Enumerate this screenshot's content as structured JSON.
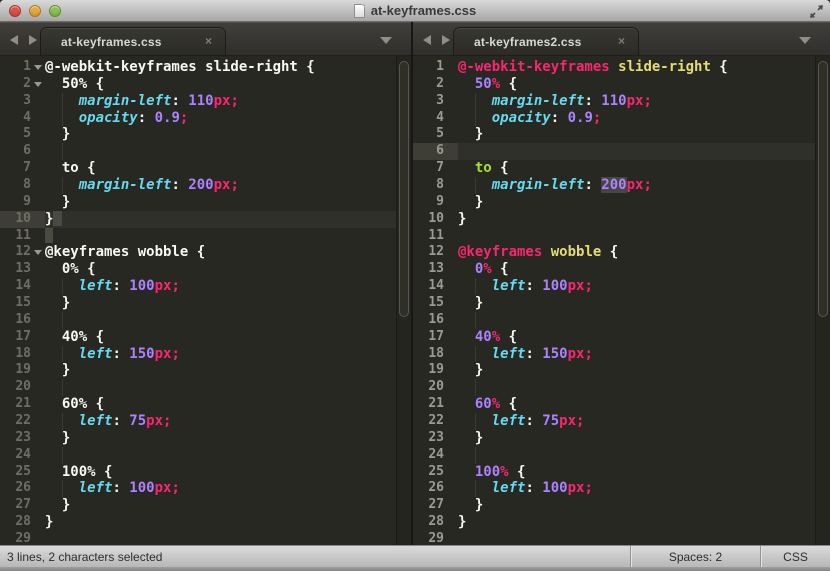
{
  "window": {
    "title": "at-keyframes.css"
  },
  "icons": {
    "tab_close": "×",
    "tab_overflow": "dropdown-triangle",
    "nav_back": "left-triangle",
    "nav_forward": "right-triangle",
    "fullscreen": "diagonal-expand-arrows",
    "traffic": [
      "close",
      "minimize",
      "zoom"
    ]
  },
  "colors": {
    "editor_bg": "#272822",
    "fg": "#f8f8f2",
    "property": "#66d9ef",
    "number": "#ae81ff",
    "unit": "#f92672",
    "at_keyword": "#f92672",
    "name": "#e6db74",
    "keyword": "#a6e22e",
    "selection": "#4b4a40"
  },
  "status_bar": {
    "left": "3 lines, 2 characters selected",
    "spaces": "Spaces: 2",
    "syntax": "CSS"
  },
  "panes": [
    {
      "tab": {
        "label": "at-keyframes.css"
      },
      "lines": [
        {
          "n": 1,
          "f": 1,
          "t": [
            [
              "w",
              "@-webkit-keyframes slide-right {"
            ]
          ]
        },
        {
          "n": 2,
          "f": 1,
          "t": [
            [
              "w",
              "  50% {"
            ]
          ]
        },
        {
          "n": 3,
          "g": [
            2
          ],
          "t": [
            [
              "w",
              "    "
            ],
            [
              "p",
              "margin-left"
            ],
            [
              "w",
              ": "
            ],
            [
              "n",
              "110"
            ],
            [
              "u",
              "px;"
            ]
          ]
        },
        {
          "n": 4,
          "g": [
            2
          ],
          "t": [
            [
              "w",
              "    "
            ],
            [
              "p",
              "opacity"
            ],
            [
              "w",
              ": "
            ],
            [
              "n",
              "0.9"
            ],
            [
              "u",
              ";"
            ]
          ]
        },
        {
          "n": 5,
          "t": [
            [
              "w",
              "  }"
            ]
          ]
        },
        {
          "n": 6,
          "g": [
            2
          ],
          "t": []
        },
        {
          "n": 7,
          "t": [
            [
              "w",
              "  to {"
            ]
          ]
        },
        {
          "n": 8,
          "g": [
            2
          ],
          "t": [
            [
              "w",
              "    "
            ],
            [
              "p",
              "margin-left"
            ],
            [
              "w",
              ": "
            ],
            [
              "n",
              "200"
            ],
            [
              "u",
              "px;"
            ]
          ]
        },
        {
          "n": 9,
          "t": [
            [
              "w",
              "  }"
            ]
          ]
        },
        {
          "n": 10,
          "a": 1,
          "t": [
            [
              "w",
              "}"
            ],
            [
              "s",
              " "
            ]
          ]
        },
        {
          "n": 11,
          "t": [
            [
              "s",
              " "
            ]
          ]
        },
        {
          "n": 12,
          "f": 1,
          "t": [
            [
              "w",
              "@keyframes wobble {"
            ]
          ]
        },
        {
          "n": 13,
          "t": [
            [
              "w",
              "  0% {"
            ]
          ]
        },
        {
          "n": 14,
          "g": [
            2
          ],
          "t": [
            [
              "w",
              "    "
            ],
            [
              "p",
              "left"
            ],
            [
              "w",
              ": "
            ],
            [
              "n",
              "100"
            ],
            [
              "u",
              "px;"
            ]
          ]
        },
        {
          "n": 15,
          "t": [
            [
              "w",
              "  }"
            ]
          ]
        },
        {
          "n": 16,
          "g": [
            2
          ],
          "t": []
        },
        {
          "n": 17,
          "t": [
            [
              "w",
              "  40% {"
            ]
          ]
        },
        {
          "n": 18,
          "g": [
            2
          ],
          "t": [
            [
              "w",
              "    "
            ],
            [
              "p",
              "left"
            ],
            [
              "w",
              ": "
            ],
            [
              "n",
              "150"
            ],
            [
              "u",
              "px;"
            ]
          ]
        },
        {
          "n": 19,
          "t": [
            [
              "w",
              "  }"
            ]
          ]
        },
        {
          "n": 20,
          "g": [
            2
          ],
          "t": []
        },
        {
          "n": 21,
          "t": [
            [
              "w",
              "  60% {"
            ]
          ]
        },
        {
          "n": 22,
          "g": [
            2
          ],
          "t": [
            [
              "w",
              "    "
            ],
            [
              "p",
              "left"
            ],
            [
              "w",
              ": "
            ],
            [
              "n",
              "75"
            ],
            [
              "u",
              "px;"
            ]
          ]
        },
        {
          "n": 23,
          "t": [
            [
              "w",
              "  }"
            ]
          ]
        },
        {
          "n": 24,
          "g": [
            2
          ],
          "t": []
        },
        {
          "n": 25,
          "t": [
            [
              "w",
              "  100% {"
            ]
          ]
        },
        {
          "n": 26,
          "g": [
            2
          ],
          "t": [
            [
              "w",
              "    "
            ],
            [
              "p",
              "left"
            ],
            [
              "w",
              ": "
            ],
            [
              "n",
              "100"
            ],
            [
              "u",
              "px;"
            ]
          ]
        },
        {
          "n": 27,
          "t": [
            [
              "w",
              "  }"
            ]
          ]
        },
        {
          "n": 28,
          "t": [
            [
              "w",
              "}"
            ]
          ]
        },
        {
          "n": 29,
          "t": []
        }
      ]
    },
    {
      "tab": {
        "label": "at-keyframes2.css"
      },
      "lines": [
        {
          "n": 1,
          "t": [
            [
              "k",
              "@-webkit-keyframes"
            ],
            [
              "w",
              " "
            ],
            [
              "y",
              "slide-right"
            ],
            [
              "w",
              " {"
            ]
          ]
        },
        {
          "n": 2,
          "t": [
            [
              "w",
              "  "
            ],
            [
              "n",
              "50"
            ],
            [
              "u",
              "%"
            ],
            [
              "w",
              " {"
            ]
          ]
        },
        {
          "n": 3,
          "g": [
            2
          ],
          "t": [
            [
              "w",
              "    "
            ],
            [
              "p",
              "margin-left"
            ],
            [
              "w",
              ": "
            ],
            [
              "n",
              "110"
            ],
            [
              "u",
              "px;"
            ]
          ]
        },
        {
          "n": 4,
          "g": [
            2
          ],
          "t": [
            [
              "w",
              "    "
            ],
            [
              "p",
              "opacity"
            ],
            [
              "w",
              ": "
            ],
            [
              "n",
              "0.9"
            ],
            [
              "u",
              ";"
            ]
          ]
        },
        {
          "n": 5,
          "t": [
            [
              "w",
              "  }"
            ]
          ]
        },
        {
          "n": 6,
          "a": 1,
          "t": []
        },
        {
          "n": 7,
          "t": [
            [
              "w",
              "  "
            ],
            [
              "g2",
              "to"
            ],
            [
              "w",
              " {"
            ]
          ]
        },
        {
          "n": 8,
          "g": [
            2
          ],
          "t": [
            [
              "w",
              "    "
            ],
            [
              "p",
              "margin-left"
            ],
            [
              "w",
              ": "
            ],
            [
              "n h",
              "200"
            ],
            [
              "u",
              "px;"
            ]
          ]
        },
        {
          "n": 9,
          "t": [
            [
              "w",
              "  }"
            ]
          ]
        },
        {
          "n": 10,
          "t": [
            [
              "w",
              "}"
            ]
          ]
        },
        {
          "n": 11,
          "t": []
        },
        {
          "n": 12,
          "t": [
            [
              "k",
              "@keyframes"
            ],
            [
              "w",
              " "
            ],
            [
              "y",
              "wobble"
            ],
            [
              "w",
              " {"
            ]
          ]
        },
        {
          "n": 13,
          "t": [
            [
              "w",
              "  "
            ],
            [
              "n",
              "0"
            ],
            [
              "u",
              "%"
            ],
            [
              "w",
              " {"
            ]
          ]
        },
        {
          "n": 14,
          "g": [
            2
          ],
          "t": [
            [
              "w",
              "    "
            ],
            [
              "p",
              "left"
            ],
            [
              "w",
              ": "
            ],
            [
              "n",
              "100"
            ],
            [
              "u",
              "px;"
            ]
          ]
        },
        {
          "n": 15,
          "t": [
            [
              "w",
              "  }"
            ]
          ]
        },
        {
          "n": 16,
          "g": [
            2
          ],
          "t": []
        },
        {
          "n": 17,
          "t": [
            [
              "w",
              "  "
            ],
            [
              "n",
              "40"
            ],
            [
              "u",
              "%"
            ],
            [
              "w",
              " {"
            ]
          ]
        },
        {
          "n": 18,
          "g": [
            2
          ],
          "t": [
            [
              "w",
              "    "
            ],
            [
              "p",
              "left"
            ],
            [
              "w",
              ": "
            ],
            [
              "n",
              "150"
            ],
            [
              "u",
              "px;"
            ]
          ]
        },
        {
          "n": 19,
          "t": [
            [
              "w",
              "  }"
            ]
          ]
        },
        {
          "n": 20,
          "g": [
            2
          ],
          "t": []
        },
        {
          "n": 21,
          "t": [
            [
              "w",
              "  "
            ],
            [
              "n",
              "60"
            ],
            [
              "u",
              "%"
            ],
            [
              "w",
              " {"
            ]
          ]
        },
        {
          "n": 22,
          "g": [
            2
          ],
          "t": [
            [
              "w",
              "    "
            ],
            [
              "p",
              "left"
            ],
            [
              "w",
              ": "
            ],
            [
              "n",
              "75"
            ],
            [
              "u",
              "px;"
            ]
          ]
        },
        {
          "n": 23,
          "t": [
            [
              "w",
              "  }"
            ]
          ]
        },
        {
          "n": 24,
          "g": [
            2
          ],
          "t": []
        },
        {
          "n": 25,
          "t": [
            [
              "w",
              "  "
            ],
            [
              "n",
              "100"
            ],
            [
              "u",
              "%"
            ],
            [
              "w",
              " {"
            ]
          ]
        },
        {
          "n": 26,
          "g": [
            2
          ],
          "t": [
            [
              "w",
              "    "
            ],
            [
              "p",
              "left"
            ],
            [
              "w",
              ": "
            ],
            [
              "n",
              "100"
            ],
            [
              "u",
              "px;"
            ]
          ]
        },
        {
          "n": 27,
          "t": [
            [
              "w",
              "  }"
            ]
          ]
        },
        {
          "n": 28,
          "t": [
            [
              "w",
              "}"
            ]
          ]
        },
        {
          "n": 29,
          "t": []
        }
      ]
    }
  ]
}
